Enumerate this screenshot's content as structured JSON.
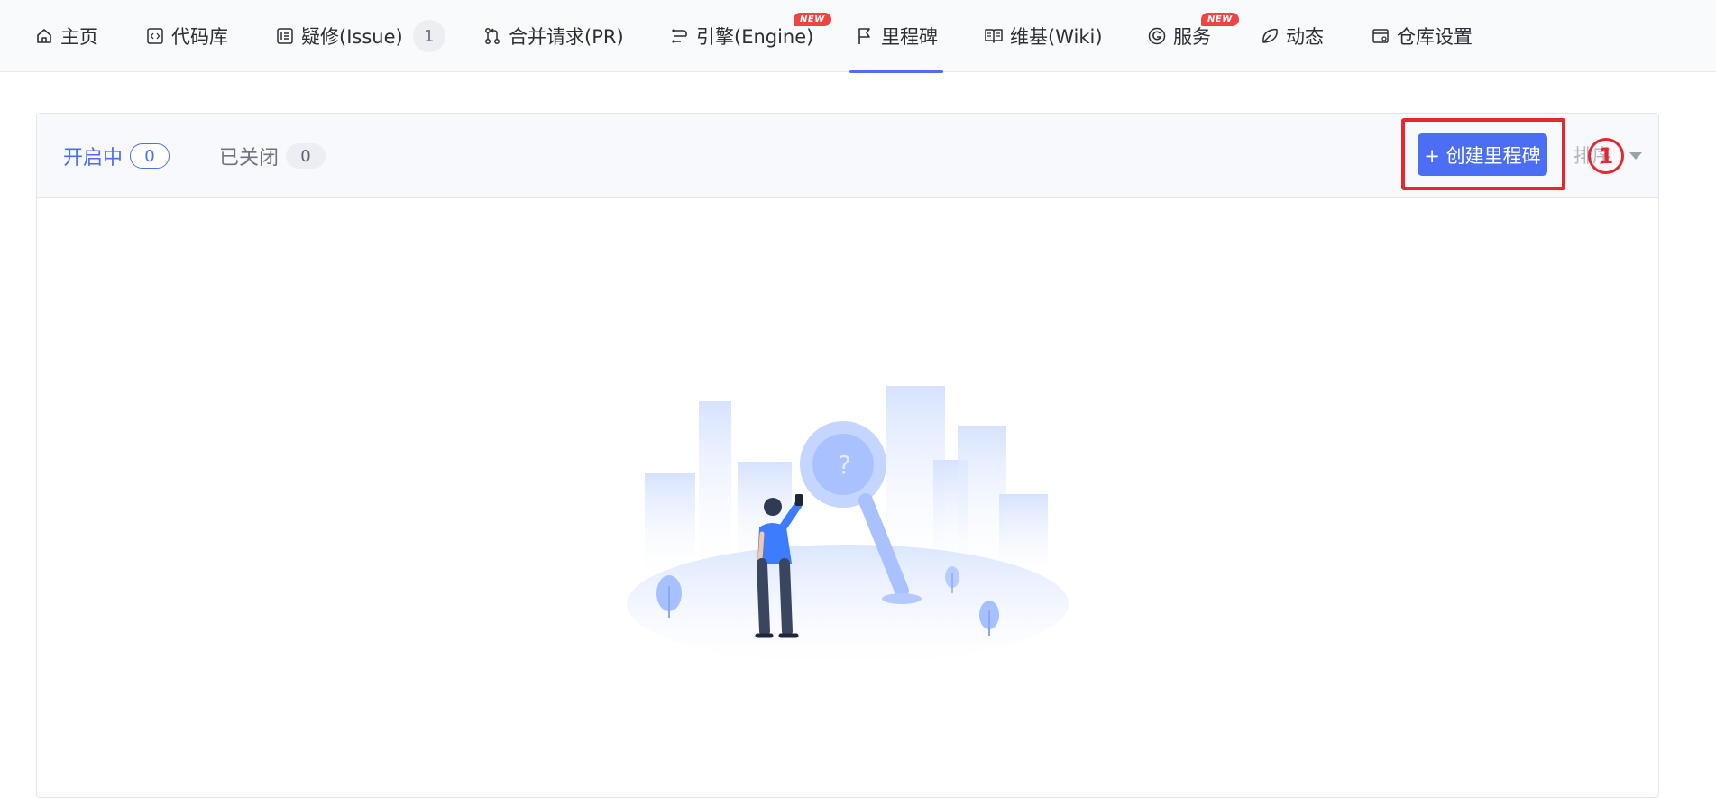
{
  "nav": {
    "items": [
      {
        "label": "主页",
        "icon": "home-icon"
      },
      {
        "label": "代码库",
        "icon": "code-icon"
      },
      {
        "label": "疑修(Issue)",
        "icon": "issue-icon",
        "count": "1"
      },
      {
        "label": "合并请求(PR)",
        "icon": "pull-request-icon"
      },
      {
        "label": "引擎(Engine)",
        "icon": "engine-icon",
        "badge": "NEW"
      },
      {
        "label": "里程碑",
        "icon": "flag-icon",
        "active": true
      },
      {
        "label": "维基(Wiki)",
        "icon": "book-icon"
      },
      {
        "label": "服务",
        "icon": "service-icon",
        "badge": "NEW"
      },
      {
        "label": "动态",
        "icon": "activity-icon"
      },
      {
        "label": "仓库设置",
        "icon": "settings-icon"
      }
    ]
  },
  "filters": {
    "open_label": "开启中",
    "open_count": "0",
    "closed_label": "已关闭",
    "closed_count": "0"
  },
  "toolbar": {
    "create_label": "+ 创建里程碑",
    "sort_label": "排序",
    "step_marker": "1"
  },
  "colors": {
    "accent": "#4c6ef5",
    "highlight": "#e8262d",
    "badge": "#ee4444"
  }
}
